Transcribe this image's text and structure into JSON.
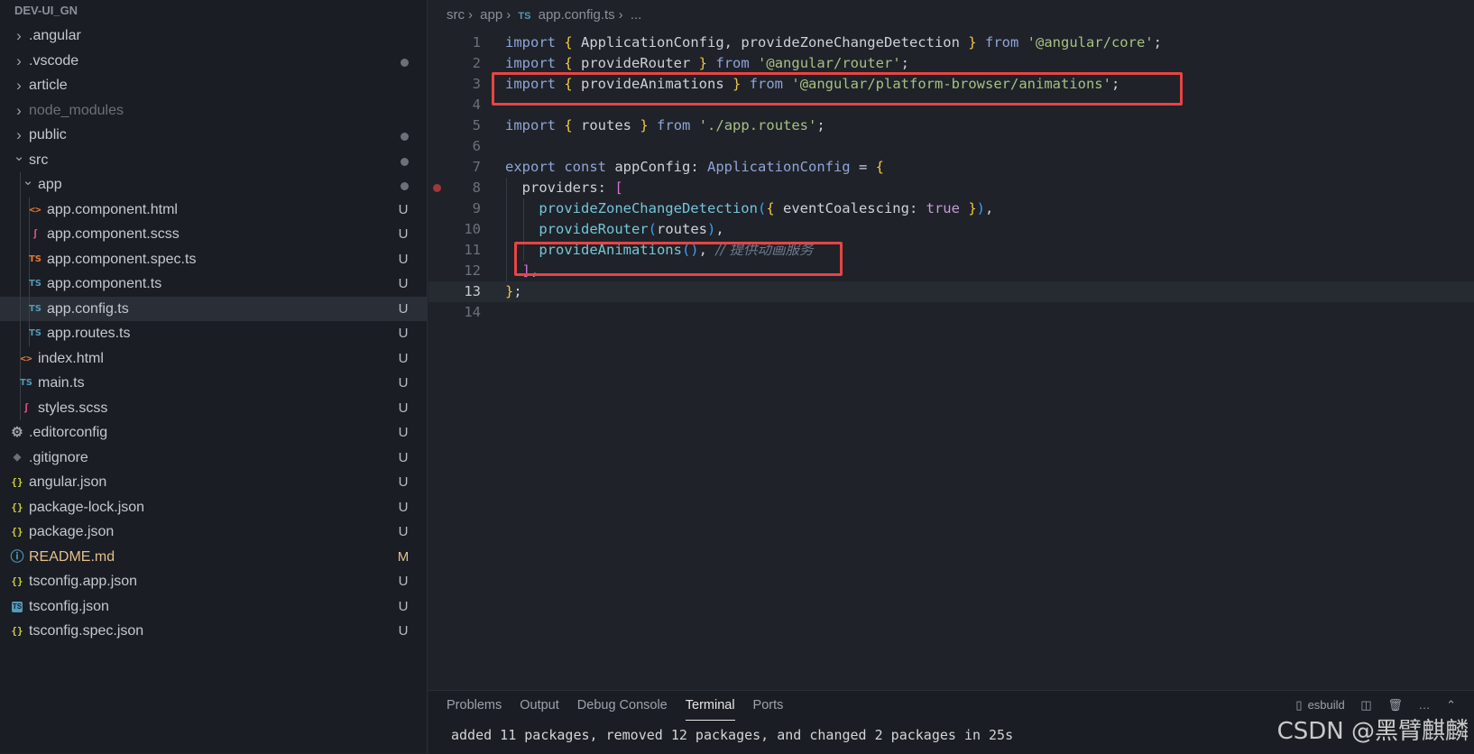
{
  "explorer": {
    "root_title": "DEV-UI_GN",
    "items": [
      {
        "label": ".angular",
        "kind": "folder",
        "depth": 0,
        "icon": "chevron-right-icon"
      },
      {
        "label": ".vscode",
        "kind": "folder",
        "depth": 0,
        "icon": "chevron-right-icon",
        "dot": true
      },
      {
        "label": "article",
        "kind": "folder",
        "depth": 0,
        "icon": "chevron-right-icon"
      },
      {
        "label": "node_modules",
        "kind": "folder",
        "depth": 0,
        "icon": "chevron-right-icon",
        "muted": true
      },
      {
        "label": "public",
        "kind": "folder",
        "depth": 0,
        "icon": "chevron-right-icon",
        "dot": true
      },
      {
        "label": "src",
        "kind": "folder-open",
        "depth": 0,
        "icon": "chevron-down-icon",
        "dot": true
      },
      {
        "label": "app",
        "kind": "folder-open",
        "depth": 1,
        "icon": "chevron-down-icon",
        "dot": true
      },
      {
        "label": "app.component.html",
        "kind": "html",
        "depth": 2,
        "badge": "U"
      },
      {
        "label": "app.component.scss",
        "kind": "scss",
        "depth": 2,
        "badge": "U"
      },
      {
        "label": "app.component.spec.ts",
        "kind": "spec",
        "depth": 2,
        "badge": "U"
      },
      {
        "label": "app.component.ts",
        "kind": "ts",
        "depth": 2,
        "badge": "U"
      },
      {
        "label": "app.config.ts",
        "kind": "ts",
        "depth": 2,
        "badge": "U",
        "selected": true
      },
      {
        "label": "app.routes.ts",
        "kind": "ts",
        "depth": 2,
        "badge": "U"
      },
      {
        "label": "index.html",
        "kind": "html",
        "depth": 1,
        "badge": "U"
      },
      {
        "label": "main.ts",
        "kind": "ts",
        "depth": 1,
        "badge": "U"
      },
      {
        "label": "styles.scss",
        "kind": "scss",
        "depth": 1,
        "badge": "U"
      },
      {
        "label": ".editorconfig",
        "kind": "gear",
        "depth": 0,
        "badge": "U"
      },
      {
        "label": ".gitignore",
        "kind": "git",
        "depth": 0,
        "badge": "U"
      },
      {
        "label": "angular.json",
        "kind": "json",
        "depth": 0,
        "badge": "U"
      },
      {
        "label": "package-lock.json",
        "kind": "json",
        "depth": 0,
        "badge": "U"
      },
      {
        "label": "package.json",
        "kind": "json",
        "depth": 0,
        "badge": "U"
      },
      {
        "label": "README.md",
        "kind": "info",
        "depth": 0,
        "badge": "M",
        "modified": true
      },
      {
        "label": "tsconfig.app.json",
        "kind": "json",
        "depth": 0,
        "badge": "U"
      },
      {
        "label": "tsconfig.json",
        "kind": "tsconfig",
        "depth": 0,
        "badge": "U"
      },
      {
        "label": "tsconfig.spec.json",
        "kind": "json",
        "depth": 0,
        "badge": "U"
      }
    ],
    "icon_glyphs": {
      "html": "<>",
      "scss": "ʃ",
      "spec": "TS",
      "ts": "TS",
      "json": "{}",
      "info": "ⓘ",
      "gear": "⚙",
      "git": "◆",
      "tsconfig": "TS"
    }
  },
  "breadcrumb": {
    "parts": [
      "src",
      "app"
    ],
    "file_icon": "TS",
    "file": "app.config.ts",
    "trail": "..."
  },
  "editor": {
    "current_line": 13,
    "breakpoint_line": 8,
    "lines": [
      {
        "n": 1,
        "tokens": [
          [
            "kw",
            "import"
          ],
          [
            "t",
            " "
          ],
          [
            "br1",
            "{"
          ],
          [
            "t",
            " ApplicationConfig, provideZoneChangeDetection "
          ],
          [
            "br1",
            "}"
          ],
          [
            "t",
            " "
          ],
          [
            "kw",
            "from"
          ],
          [
            "t",
            " "
          ],
          [
            "str",
            "'@angular/core'"
          ],
          [
            "t",
            ";"
          ]
        ]
      },
      {
        "n": 2,
        "tokens": [
          [
            "kw",
            "import"
          ],
          [
            "t",
            " "
          ],
          [
            "br1",
            "{"
          ],
          [
            "t",
            " provideRouter "
          ],
          [
            "br1",
            "}"
          ],
          [
            "t",
            " "
          ],
          [
            "kw",
            "from"
          ],
          [
            "t",
            " "
          ],
          [
            "str",
            "'@angular/router'"
          ],
          [
            "t",
            ";"
          ]
        ]
      },
      {
        "n": 3,
        "tokens": [
          [
            "kw",
            "import"
          ],
          [
            "t",
            " "
          ],
          [
            "br1",
            "{"
          ],
          [
            "t",
            " provideAnimations "
          ],
          [
            "br1",
            "}"
          ],
          [
            "t",
            " "
          ],
          [
            "kw",
            "from"
          ],
          [
            "t",
            " "
          ],
          [
            "str",
            "'@angular/platform-browser/animations'"
          ],
          [
            "t",
            ";"
          ]
        ]
      },
      {
        "n": 4,
        "tokens": []
      },
      {
        "n": 5,
        "tokens": [
          [
            "kw",
            "import"
          ],
          [
            "t",
            " "
          ],
          [
            "br1",
            "{"
          ],
          [
            "t",
            " routes "
          ],
          [
            "br1",
            "}"
          ],
          [
            "t",
            " "
          ],
          [
            "kw",
            "from"
          ],
          [
            "t",
            " "
          ],
          [
            "str",
            "'./app.routes'"
          ],
          [
            "t",
            ";"
          ]
        ]
      },
      {
        "n": 6,
        "tokens": []
      },
      {
        "n": 7,
        "tokens": [
          [
            "kw",
            "export"
          ],
          [
            "t",
            " "
          ],
          [
            "kw",
            "const"
          ],
          [
            "t",
            " appConfig: "
          ],
          [
            "typ",
            "ApplicationConfig"
          ],
          [
            "t",
            " = "
          ],
          [
            "br1",
            "{"
          ]
        ]
      },
      {
        "n": 8,
        "tokens": [
          [
            "t",
            "  providers: "
          ],
          [
            "br2",
            "["
          ]
        ]
      },
      {
        "n": 9,
        "tokens": [
          [
            "t",
            "    "
          ],
          [
            "fn",
            "provideZoneChangeDetection"
          ],
          [
            "br3",
            "("
          ],
          [
            "br1",
            "{"
          ],
          [
            "t",
            " eventCoalescing: "
          ],
          [
            "bool",
            "true"
          ],
          [
            "t",
            " "
          ],
          [
            "br1",
            "}"
          ],
          [
            "br3",
            ")"
          ],
          [
            "t",
            ","
          ]
        ]
      },
      {
        "n": 10,
        "tokens": [
          [
            "t",
            "    "
          ],
          [
            "fn",
            "provideRouter"
          ],
          [
            "br3",
            "("
          ],
          [
            "t",
            "routes"
          ],
          [
            "br3",
            ")"
          ],
          [
            "t",
            ","
          ]
        ]
      },
      {
        "n": 11,
        "tokens": [
          [
            "t",
            "    "
          ],
          [
            "fn",
            "provideAnimations"
          ],
          [
            "br3",
            "()"
          ],
          [
            "t",
            ", "
          ],
          [
            "cmt",
            "// 提供动画服务"
          ]
        ]
      },
      {
        "n": 12,
        "tokens": [
          [
            "t",
            "  "
          ],
          [
            "br2",
            "]"
          ],
          [
            "t",
            ","
          ]
        ]
      },
      {
        "n": 13,
        "tokens": [
          [
            "br1",
            "}"
          ],
          [
            "t",
            ";"
          ]
        ]
      },
      {
        "n": 14,
        "tokens": []
      }
    ]
  },
  "panel": {
    "tabs": [
      "Problems",
      "Output",
      "Debug Console",
      "Terminal",
      "Ports"
    ],
    "active_tab": "Terminal",
    "terminal_name": "esbuild",
    "output": "added 11 packages, removed 12 packages, and changed 2 packages in 25s"
  },
  "watermark": "CSDN @黑臂麒麟",
  "colors": {
    "highlight_box": "#e84444",
    "modified": "#e2c08d"
  }
}
